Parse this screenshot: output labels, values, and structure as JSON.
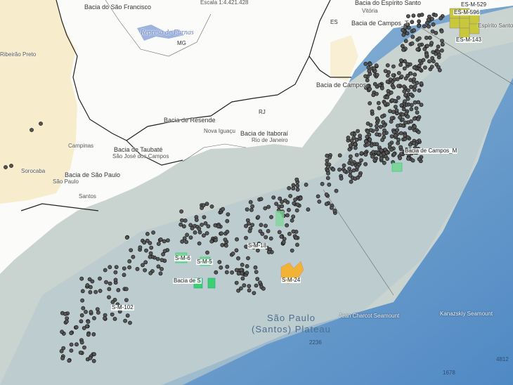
{
  "map": {
    "top_text": "Escala 1:4.421.428",
    "labels": {
      "bacia_sao_francisco": "Bacia do São Francisco",
      "bacia_espirito_santo": "Bacia do Espírito Santo",
      "vitoria": "Vitória",
      "espirito_santo": "Espírito Santo",
      "represa_furnas": "Represa de Furnas",
      "mg": "MG",
      "es": "ES",
      "bacia_campos_t": "Bacia de Campos_T",
      "bacia_campos": "Bacia de Campos",
      "ribeirao_preto": "Ribeirão Preto",
      "rj": "RJ",
      "bacia_resende": "Bacia de Resende",
      "nova_iguacu": "Nova Iguaçu",
      "bacia_itaborai": "Bacia de Itaboraí",
      "rio_de_janeiro": "Rio de Janeiro",
      "campinas": "Campinas",
      "bacia_taubate": "Bacia de Taubaté",
      "sao_jose_campos": "São José dos Campos",
      "sorocaba": "Sorocaba",
      "bacia_sao_paulo": "Bacia de São Paulo",
      "sao_paulo": "São Paulo",
      "santos": "Santos",
      "plateau_line1": "São Paulo",
      "plateau_line2": "(Santos) Plateau",
      "jean_charcot": "Jean Charcot Seamount",
      "kanazskiy": "Kanazskiy Seamount",
      "depth_2236": "2236",
      "depth_1678": "1678",
      "depth_4812": "4812"
    },
    "blocks": {
      "es_m_596": "ES-M-596",
      "es_m_529": "ES-M-529",
      "es_m_143": "ES-M-143",
      "campos_m": "Bacia de Campos_M",
      "s_m_18": "S-M-18",
      "s_m_6": "S-M-6",
      "s_m_5": "S-M-5",
      "bacia_s": "Bacia de S",
      "s_m_24": "S-M-24",
      "s_m_102": "S-M-102"
    },
    "colors": {
      "land": "#ffffff",
      "basin_onshore": "#f7eccb",
      "ocean_shelf": "#c9d3d0",
      "ocean_deep": "#7fa9cf",
      "well_marker": "#555555",
      "block_green": "#7fd49a",
      "block_orange": "#f2b233",
      "block_yellow": "#c8c83a",
      "border_line": "#222222",
      "water_body": "#9fb3df"
    }
  }
}
